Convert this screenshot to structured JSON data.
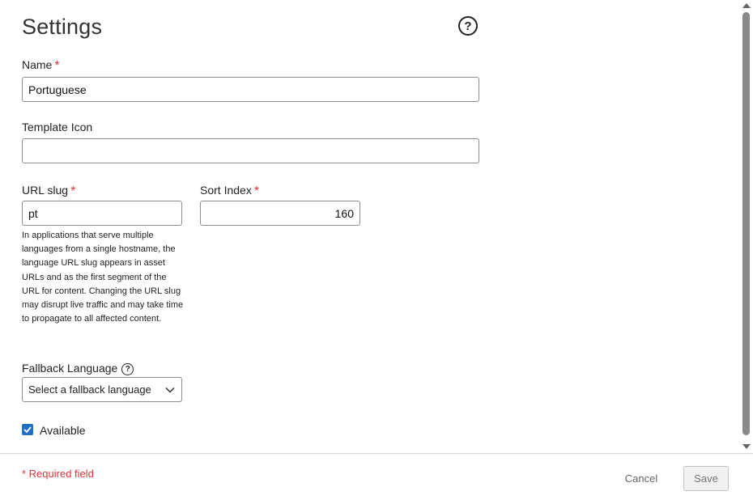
{
  "header": {
    "title": "Settings",
    "help_icon": "question-circle-icon",
    "help_glyph": "?"
  },
  "form": {
    "name": {
      "label": "Name",
      "required_mark": "*",
      "value": "Portuguese"
    },
    "template_icon": {
      "label": "Template Icon",
      "value": ""
    },
    "url_slug": {
      "label": "URL slug",
      "required_mark": "*",
      "value": "pt",
      "help": "In applications that serve multiple languages from a single hostname, the language URL slug appears in asset URLs and as the first segment of the URL for content. Changing the URL slug may disrupt live traffic and may take time to propagate to all affected content."
    },
    "sort_index": {
      "label": "Sort Index",
      "required_mark": "*",
      "value": "160"
    },
    "fallback_language": {
      "label": "Fallback Language",
      "help_glyph": "?",
      "selected": "Select a fallback language",
      "chevron_icon": "chevron-down-icon"
    },
    "available": {
      "label": "Available",
      "checked": true
    }
  },
  "footer": {
    "required_note": "* Required field",
    "cancel_label": "Cancel",
    "save_label": "Save"
  },
  "colors": {
    "required": "#e0353b",
    "checkbox": "#1f6fc4",
    "border": "#8c8c8c"
  }
}
